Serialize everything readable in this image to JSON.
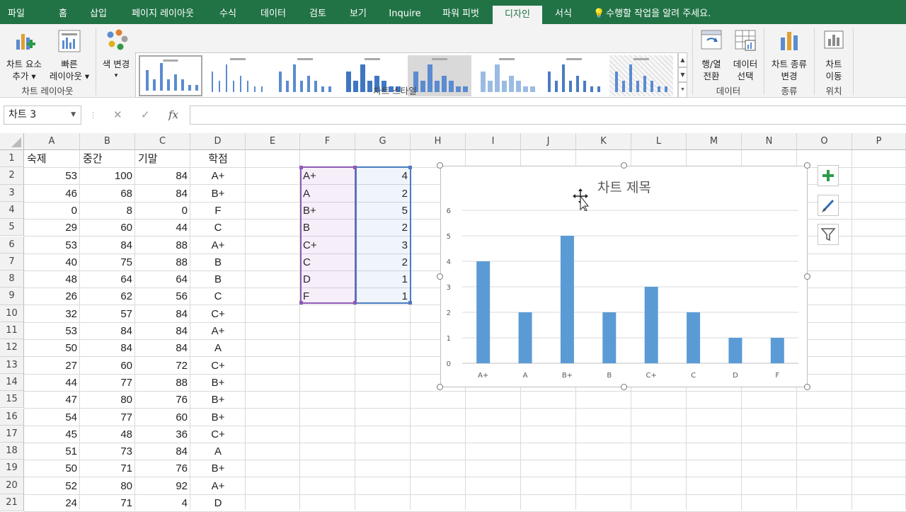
{
  "tabs": [
    {
      "label": "파일",
      "active": false
    },
    {
      "label": "홈",
      "active": false
    },
    {
      "label": "삽입",
      "active": false
    },
    {
      "label": "페이지 레이아웃",
      "active": false
    },
    {
      "label": "수식",
      "active": false
    },
    {
      "label": "데이터",
      "active": false
    },
    {
      "label": "검토",
      "active": false
    },
    {
      "label": "보기",
      "active": false
    },
    {
      "label": "Inquire",
      "active": false
    },
    {
      "label": "파워 피벗",
      "active": false
    },
    {
      "label": "디자인",
      "active": true
    },
    {
      "label": "서식",
      "active": false
    }
  ],
  "tell_me": "수행할 작업을 알려 주세요.",
  "ribbon": {
    "add_element": [
      "차트 요소",
      "추가 ▾"
    ],
    "quick_layout": [
      "빠른",
      "레이아웃 ▾"
    ],
    "group_layout": "차트 레이아웃",
    "change_color": [
      "색 변경",
      "▾"
    ],
    "group_styles": "차트 스타일",
    "switch_row_col": [
      "행/열",
      "전환"
    ],
    "select_data": [
      "데이터",
      "선택"
    ],
    "group_data": "데이터",
    "change_type": [
      "차트 종류",
      "변경"
    ],
    "group_type": "종류",
    "move_chart": [
      "차트",
      "이동"
    ],
    "group_location": "위치"
  },
  "formula_bar": {
    "name_box": "차트 3",
    "cancel": "✕",
    "enter": "✓",
    "fx": "fx",
    "formula": ""
  },
  "columns": [
    "A",
    "B",
    "C",
    "D",
    "E",
    "F",
    "G",
    "H",
    "I",
    "J",
    "K",
    "L",
    "M",
    "N",
    "O",
    "P"
  ],
  "rows": [
    "1",
    "2",
    "3",
    "4",
    "5",
    "6",
    "7",
    "8",
    "9",
    "10",
    "11",
    "12",
    "13",
    "14",
    "15",
    "16",
    "17",
    "18",
    "19",
    "20",
    "21"
  ],
  "sheet": {
    "headers": [
      "숙제",
      "중간",
      "기말",
      "학점"
    ],
    "data": [
      [
        "53",
        "100",
        "84",
        "A+"
      ],
      [
        "46",
        "68",
        "84",
        "B+"
      ],
      [
        "0",
        "8",
        "0",
        "F"
      ],
      [
        "29",
        "60",
        "44",
        "C"
      ],
      [
        "53",
        "84",
        "88",
        "A+"
      ],
      [
        "40",
        "75",
        "88",
        "B"
      ],
      [
        "48",
        "64",
        "64",
        "B"
      ],
      [
        "26",
        "62",
        "56",
        "C"
      ],
      [
        "32",
        "57",
        "84",
        "C+"
      ],
      [
        "53",
        "84",
        "84",
        "A+"
      ],
      [
        "50",
        "84",
        "84",
        "A"
      ],
      [
        "27",
        "60",
        "72",
        "C+"
      ],
      [
        "44",
        "77",
        "88",
        "B+"
      ],
      [
        "47",
        "80",
        "76",
        "B+"
      ],
      [
        "54",
        "77",
        "60",
        "B+"
      ],
      [
        "45",
        "48",
        "36",
        "C+"
      ],
      [
        "51",
        "73",
        "84",
        "A"
      ],
      [
        "50",
        "71",
        "76",
        "B+"
      ],
      [
        "52",
        "80",
        "92",
        "A+"
      ],
      [
        "24",
        "71",
        "4",
        "D"
      ]
    ],
    "summary": [
      [
        "A+",
        "4"
      ],
      [
        "A",
        "2"
      ],
      [
        "B+",
        "5"
      ],
      [
        "B",
        "2"
      ],
      [
        "C+",
        "3"
      ],
      [
        "C",
        "2"
      ],
      [
        "D",
        "1"
      ],
      [
        "F",
        "1"
      ]
    ]
  },
  "colors": {
    "excel_green": "#217346",
    "bar_blue": "#5b9bd5",
    "purple_range": "#8e5bb5",
    "blue_range": "#4a7cc0"
  },
  "chart_data": {
    "type": "bar",
    "title": "차트 제목",
    "categories": [
      "A+",
      "A",
      "B+",
      "B",
      "C+",
      "C",
      "D",
      "F"
    ],
    "values": [
      4,
      2,
      5,
      2,
      3,
      2,
      1,
      1
    ],
    "ylim": [
      0,
      6
    ],
    "yticks": [
      "0",
      "1",
      "2",
      "3",
      "4",
      "5",
      "6"
    ],
    "grid": true,
    "legend": "none",
    "bar_color": "#5b9bd5"
  }
}
